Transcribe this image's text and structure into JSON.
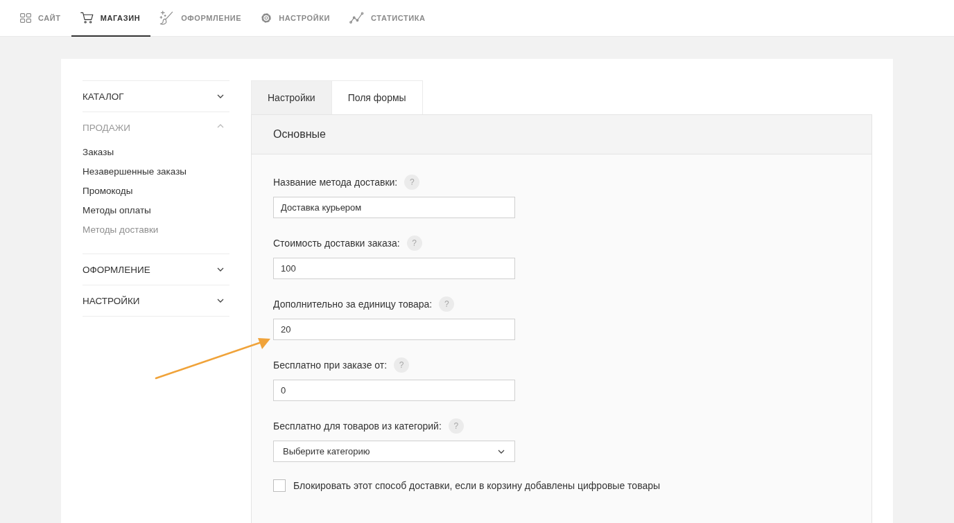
{
  "top_nav": [
    {
      "label": "САЙТ",
      "selected": false
    },
    {
      "label": "МАГАЗИН",
      "selected": true
    },
    {
      "label": "ОФОРМЛЕНИЕ",
      "selected": false
    },
    {
      "label": "НАСТРОЙКИ",
      "selected": false
    },
    {
      "label": "СТАТИСТИКА",
      "selected": false
    }
  ],
  "sidebar": {
    "sections": [
      {
        "label": "КАТАЛОГ",
        "expanded": false
      },
      {
        "label": "ПРОДАЖИ",
        "expanded": true,
        "items": [
          {
            "label": "Заказы",
            "selected": false
          },
          {
            "label": "Незавершенные заказы",
            "selected": false
          },
          {
            "label": "Промокоды",
            "selected": false
          },
          {
            "label": "Методы оплаты",
            "selected": false
          },
          {
            "label": "Методы доставки",
            "selected": true
          }
        ]
      },
      {
        "label": "ОФОРМЛЕНИЕ",
        "expanded": false
      },
      {
        "label": "НАСТРОЙКИ",
        "expanded": false
      }
    ]
  },
  "tabs": [
    {
      "label": "Настройки",
      "selected": true
    },
    {
      "label": "Поля формы",
      "selected": false
    }
  ],
  "panel": {
    "title": "Основные",
    "fields": [
      {
        "kind": "text",
        "label": "Название метода доставки:",
        "help": "?",
        "value": "Доставка курьером"
      },
      {
        "kind": "text",
        "label": "Стоимость доставки заказа:",
        "help": "?",
        "value": "100"
      },
      {
        "kind": "text",
        "label": "Дополнительно за единицу товара:",
        "help": "?",
        "value": "20"
      },
      {
        "kind": "text",
        "label": "Бесплатно при заказе от:",
        "help": "?",
        "value": "0"
      },
      {
        "kind": "select",
        "label": "Бесплатно для товаров из категорий:",
        "help": "?",
        "value": "Выберите категорию"
      }
    ],
    "checkbox": {
      "label": "Блокировать этот способ доставки, если в корзину добавлены цифровые товары",
      "checked": false
    }
  }
}
